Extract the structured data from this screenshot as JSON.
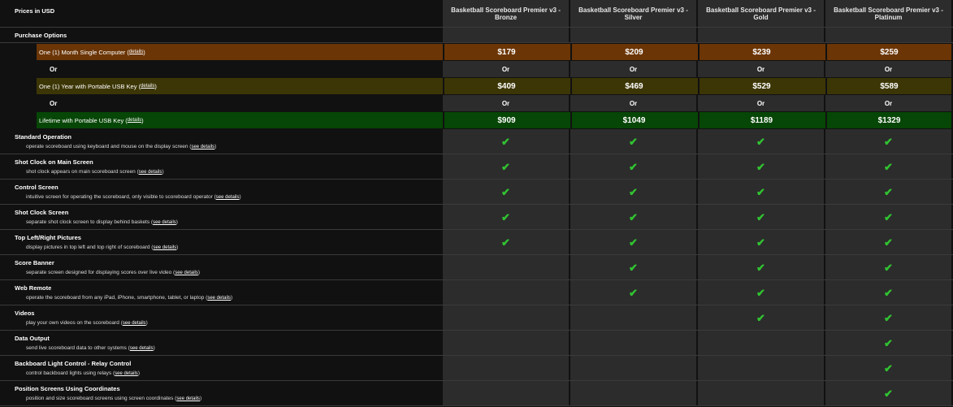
{
  "header": {
    "prices_label": "Prices in USD",
    "columns": [
      "Basketball Scoreboard Premier v3 - Bronze",
      "Basketball Scoreboard Premier v3 - Silver",
      "Basketball Scoreboard Premier v3 - Gold",
      "Basketball Scoreboard Premier v3 - Platinum"
    ]
  },
  "purchase": {
    "label": "Purchase Options",
    "or_label": "Or",
    "details_link": "details",
    "options": [
      {
        "label": "One (1) Month Single Computer",
        "prices": [
          "$179",
          "$209",
          "$239",
          "$259"
        ],
        "color": "#6b3506"
      },
      {
        "label": "One (1) Year with Portable USB Key",
        "prices": [
          "$409",
          "$469",
          "$529",
          "$589"
        ],
        "color": "#3c3606"
      },
      {
        "label": "Lifetime with Portable USB Key",
        "prices": [
          "$909",
          "$1049",
          "$1189",
          "$1329"
        ],
        "color": "#064606"
      }
    ]
  },
  "features_link": "see details",
  "check_glyph": "✔",
  "check_color": "#31c331",
  "features": [
    {
      "title": "Standard Operation",
      "desc": "operate scoreboard using keyboard and mouse on the display screen",
      "tiers": [
        true,
        true,
        true,
        true
      ]
    },
    {
      "title": "Shot Clock on Main Screen",
      "desc": "shot clock appears on main scoreboard screen",
      "tiers": [
        true,
        true,
        true,
        true
      ],
      "nolink": true
    },
    {
      "title": "Control Screen",
      "desc": "intuitive screen for operating the scoreboard, only visible to scoreboard operator",
      "tiers": [
        true,
        true,
        true,
        true
      ]
    },
    {
      "title": "Shot Clock Screen",
      "desc": "separate shot clock screen to display behind baskets",
      "tiers": [
        true,
        true,
        true,
        true
      ]
    },
    {
      "title": "Top Left/Right Pictures",
      "desc": "display pictures in top left and top right of scoreboard",
      "tiers": [
        true,
        true,
        true,
        true
      ]
    },
    {
      "title": "Score Banner",
      "desc": "separate screen designed for displaying scores over live video",
      "tiers": [
        false,
        true,
        true,
        true
      ]
    },
    {
      "title": "Web Remote",
      "desc": "operate the scoreboard from any iPad, iPhone, smartphone, tablet, or laptop",
      "tiers": [
        false,
        true,
        true,
        true
      ]
    },
    {
      "title": "Videos",
      "desc": "play your own videos on the scoreboard",
      "tiers": [
        false,
        false,
        true,
        true
      ]
    },
    {
      "title": "Data Output",
      "desc": "send live scoreboard data to other systems",
      "tiers": [
        false,
        false,
        false,
        true
      ]
    },
    {
      "title": "Backboard Light Control - Relay Control",
      "desc": "control backboard lights using relays",
      "tiers": [
        false,
        false,
        false,
        true
      ]
    },
    {
      "title": "Position Screens Using Coordinates",
      "desc": "position and size scoreboard screens using screen coordinates",
      "tiers": [
        false,
        false,
        false,
        true
      ]
    }
  ]
}
